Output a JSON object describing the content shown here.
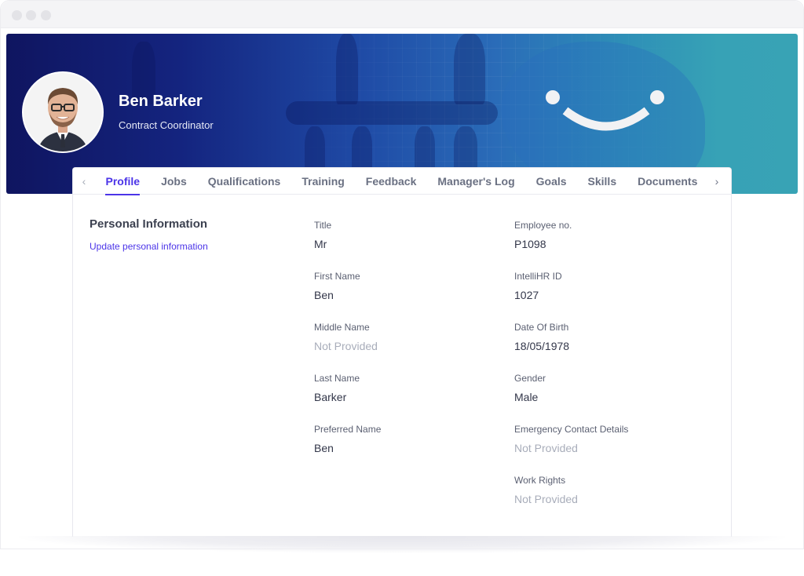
{
  "window": {
    "controls": [
      "window-dot",
      "window-dot",
      "window-dot"
    ]
  },
  "profile": {
    "name": "Ben Barker",
    "role": "Contract Coordinator",
    "avatar_icon": "person-photo",
    "logo_icon": "smiley-logo"
  },
  "tabs": {
    "prev_icon": "‹",
    "next_icon": "›",
    "items": [
      {
        "label": "Profile",
        "active": true
      },
      {
        "label": "Jobs",
        "active": false
      },
      {
        "label": "Qualifications",
        "active": false
      },
      {
        "label": "Training",
        "active": false
      },
      {
        "label": "Feedback",
        "active": false
      },
      {
        "label": "Manager's Log",
        "active": false
      },
      {
        "label": "Goals",
        "active": false
      },
      {
        "label": "Skills",
        "active": false
      },
      {
        "label": "Documents",
        "active": false
      }
    ]
  },
  "section": {
    "title": "Personal Information",
    "update_link": "Update personal information"
  },
  "fields_left": [
    {
      "label": "Title",
      "value": "Mr",
      "empty": false
    },
    {
      "label": "First Name",
      "value": "Ben",
      "empty": false
    },
    {
      "label": "Middle Name",
      "value": "Not Provided",
      "empty": true
    },
    {
      "label": "Last Name",
      "value": "Barker",
      "empty": false
    },
    {
      "label": "Preferred Name",
      "value": "Ben",
      "empty": false
    }
  ],
  "fields_right": [
    {
      "label": "Employee no.",
      "value": "P1098",
      "empty": false
    },
    {
      "label": "IntelliHR ID",
      "value": "1027",
      "empty": false
    },
    {
      "label": "Date Of Birth",
      "value": "18/05/1978",
      "empty": false
    },
    {
      "label": "Gender",
      "value": "Male",
      "empty": false
    },
    {
      "label": "Emergency Contact Details",
      "value": "Not Provided",
      "empty": true
    },
    {
      "label": "Work Rights",
      "value": "Not Provided",
      "empty": true
    }
  ],
  "colors": {
    "accent": "#4b34e8",
    "banner_start": "#0f1560",
    "banner_end": "#38a3b5",
    "muted_value": "#a8adba"
  }
}
